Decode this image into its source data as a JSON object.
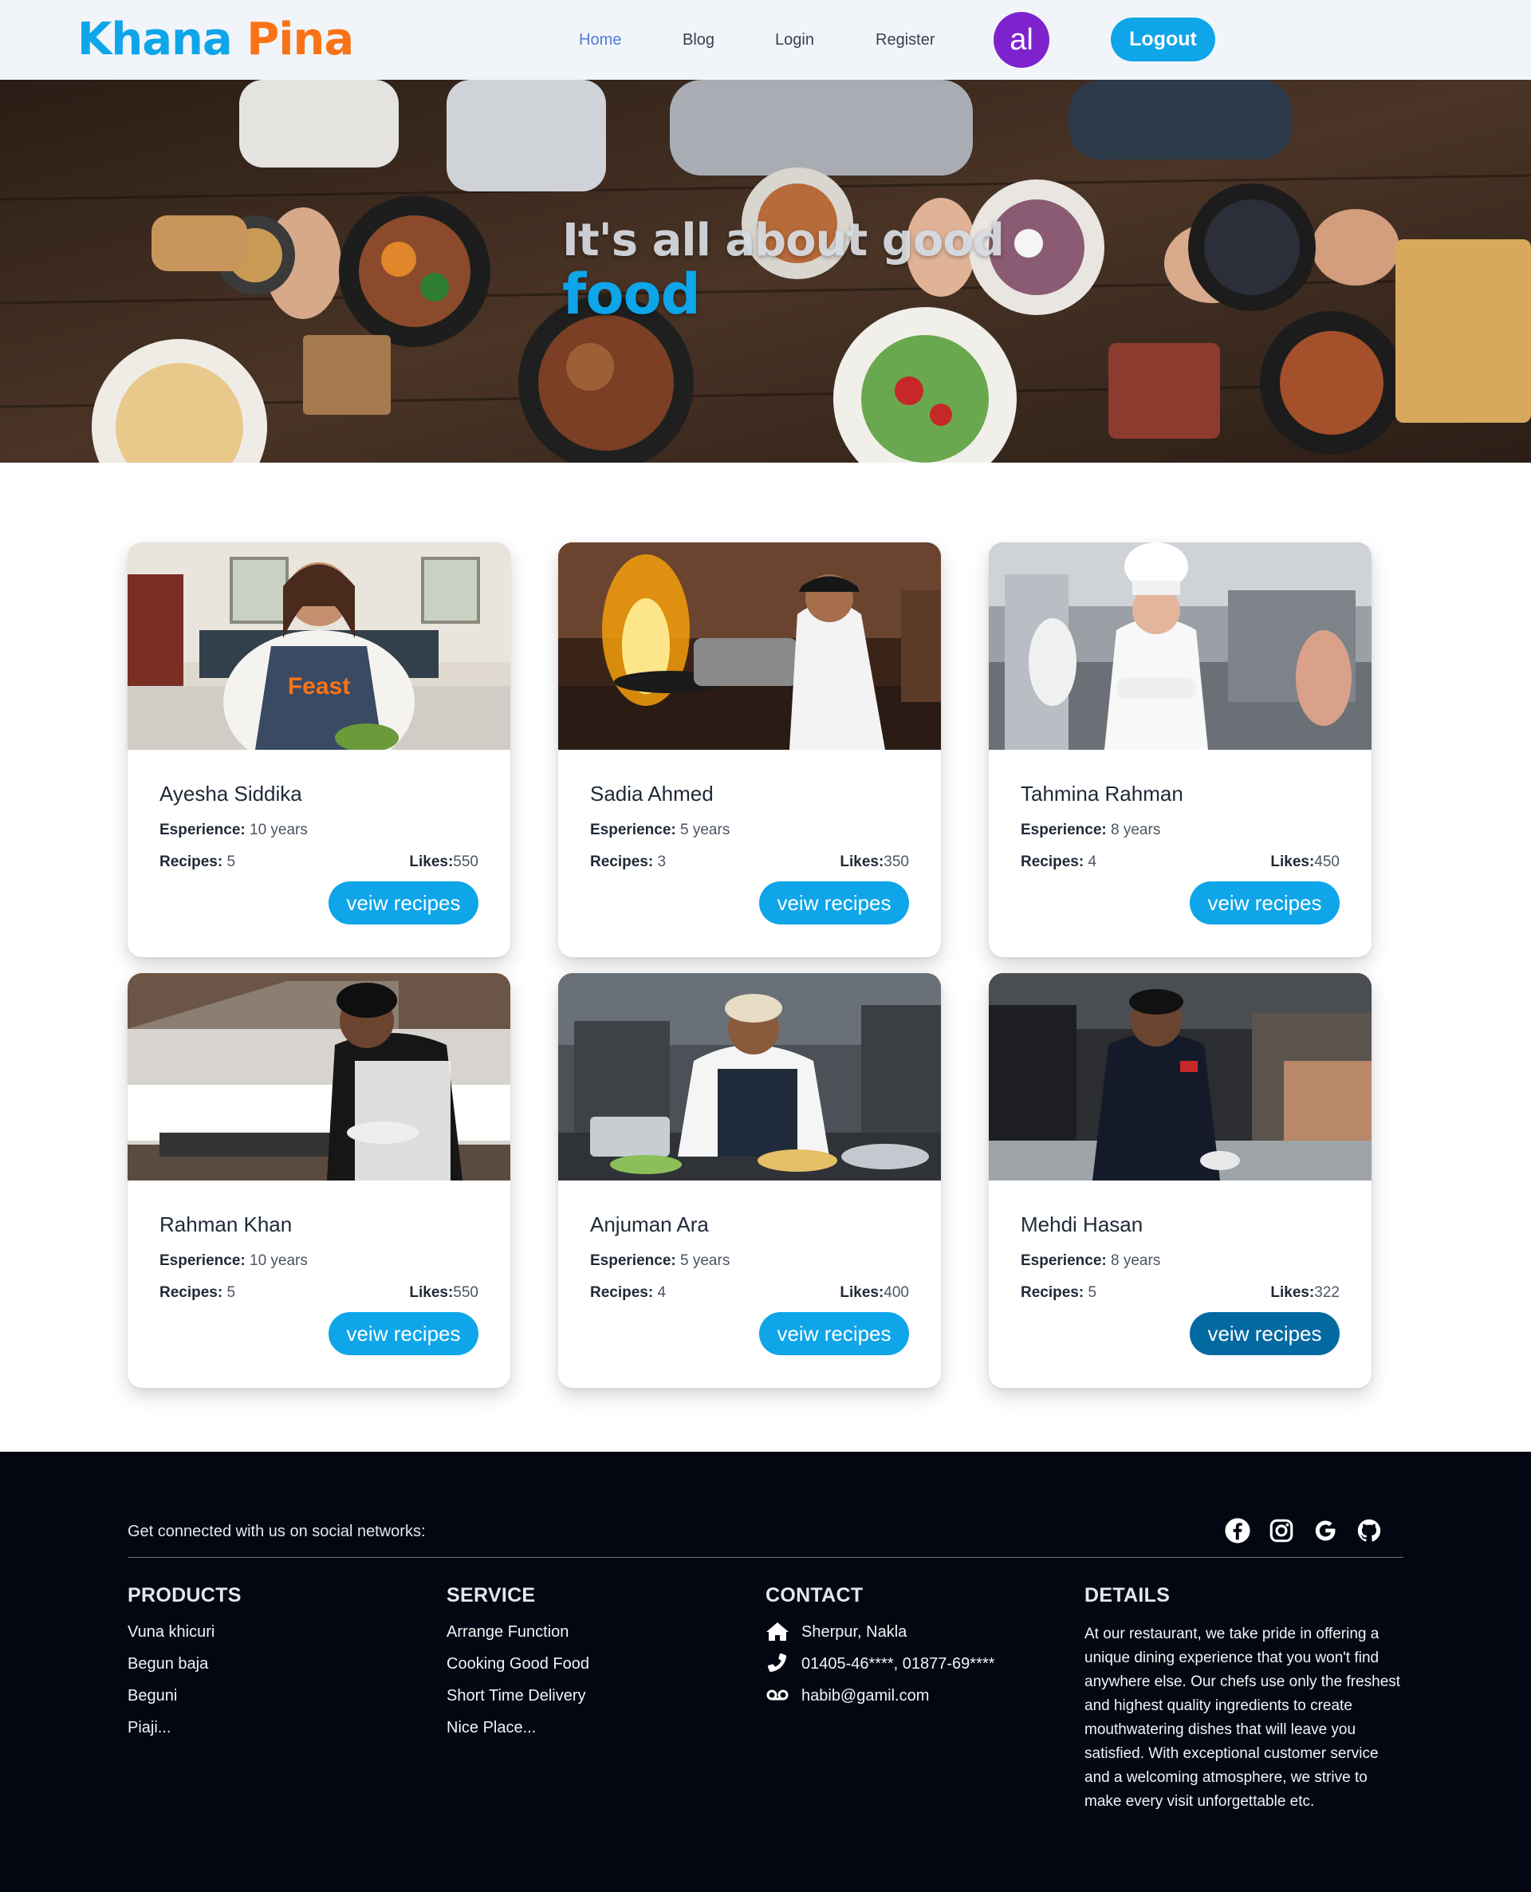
{
  "brand": {
    "part1": "Khana",
    "part2": "Pina"
  },
  "nav": {
    "links": [
      {
        "label": "Home",
        "active": true
      },
      {
        "label": "Blog",
        "active": false
      },
      {
        "label": "Login",
        "active": false
      },
      {
        "label": "Register",
        "active": false
      }
    ],
    "avatar_initials": "al",
    "logout_label": "Logout"
  },
  "hero": {
    "line1": "It's all about good",
    "line2": "food"
  },
  "chefs": [
    {
      "name": "Ayesha Siddika",
      "experience_label": "Esperience:",
      "experience": "10 years",
      "recipes_label": "Recipes:",
      "recipes": "5",
      "likes_label": "Likes:",
      "likes": "550",
      "button_label": "veiw recipes",
      "apron_text": "Feast"
    },
    {
      "name": "Sadia Ahmed",
      "experience_label": "Esperience:",
      "experience": "5 years",
      "recipes_label": "Recipes:",
      "recipes": "3",
      "likes_label": "Likes:",
      "likes": "350",
      "button_label": "veiw recipes"
    },
    {
      "name": "Tahmina Rahman",
      "experience_label": "Esperience:",
      "experience": "8 years",
      "recipes_label": "Recipes:",
      "recipes": "4",
      "likes_label": "Likes:",
      "likes": "450",
      "button_label": "veiw recipes"
    },
    {
      "name": "Rahman Khan",
      "experience_label": "Esperience:",
      "experience": "10 years",
      "recipes_label": "Recipes:",
      "recipes": "5",
      "likes_label": "Likes:",
      "likes": "550",
      "button_label": "veiw recipes"
    },
    {
      "name": "Anjuman Ara",
      "experience_label": "Esperience:",
      "experience": "5 years",
      "recipes_label": "Recipes:",
      "recipes": "4",
      "likes_label": "Likes:",
      "likes": "400",
      "button_label": "veiw recipes"
    },
    {
      "name": "Mehdi Hasan",
      "experience_label": "Esperience:",
      "experience": "8 years",
      "recipes_label": "Recipes:",
      "recipes": "5",
      "likes_label": "Likes:",
      "likes": "322",
      "button_label": "veiw recipes"
    }
  ],
  "footer": {
    "social_text": "Get connected with us on social networks:",
    "social_icons": [
      "facebook-icon",
      "instagram-icon",
      "google-icon",
      "github-icon"
    ],
    "products": {
      "title": "PRODUCTS",
      "items": [
        "Vuna khicuri",
        "Begun baja",
        "Beguni",
        "Piaji..."
      ]
    },
    "service": {
      "title": "SERVICE",
      "items": [
        "Arrange Function",
        "Cooking Good Food",
        "Short Time Delivery",
        "Nice Place..."
      ]
    },
    "contact": {
      "title": "CONTACT",
      "items": [
        {
          "icon": "home-icon",
          "text": "Sherpur, Nakla"
        },
        {
          "icon": "phone-icon",
          "text": "01405-46****, 01877-69****"
        },
        {
          "icon": "voicemail-icon",
          "text": "habib@gamil.com"
        }
      ]
    },
    "details": {
      "title": "DETAILS",
      "text": "At our restaurant, we take pride in offering a unique dining experience that you won't find anywhere else. Our chefs use only the freshest and highest quality ingredients to create mouthwatering dishes that will leave you satisfied. With exceptional customer service and a welcoming atmosphere, we strive to make every visit unforgettable etc."
    }
  },
  "colors": {
    "accent": "#0ea5e9",
    "accent_dark": "#0369a1",
    "brand_orange": "#f97316",
    "avatar_purple": "#7e22ce",
    "footer_bg": "#030712",
    "navbar_bg": "#f1f5f9"
  }
}
